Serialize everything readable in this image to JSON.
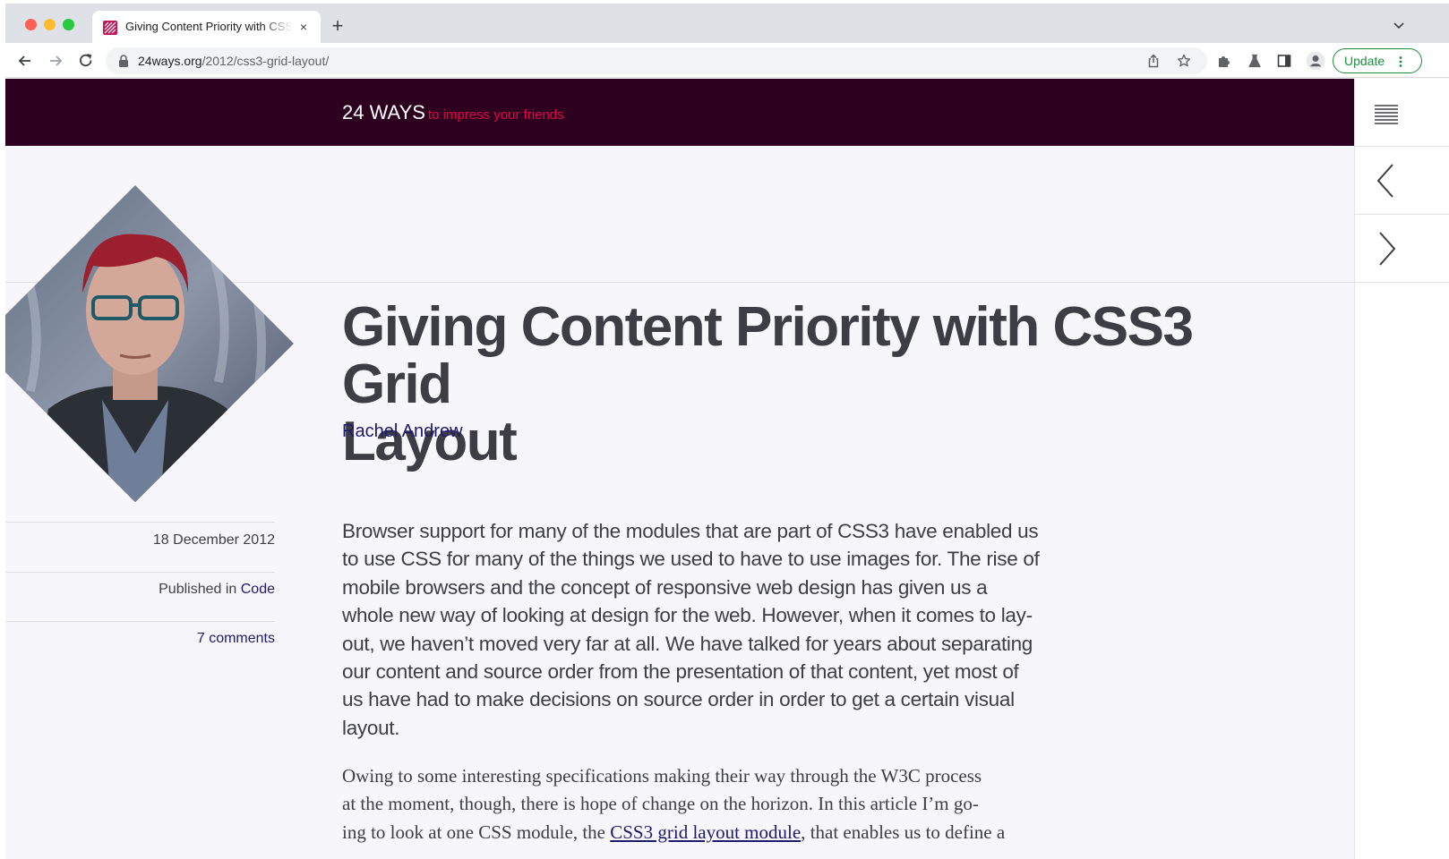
{
  "browser": {
    "tab_title": "Giving Content Priority with CSS3 Grid Layout",
    "tab_close": "×",
    "new_tab": "+",
    "url_host": "24ways.org",
    "url_path": "/2012/css3-grid-layout/",
    "update_label": "Update",
    "colors": {
      "update_green": "#1e8e3e",
      "tab_bar": "#dee1e6"
    }
  },
  "site": {
    "name": "24 WAYS",
    "tagline": "to impress your friends",
    "colors": {
      "masthead": "#2c001e",
      "tagline": "#e6004c",
      "link": "#1d1a6e"
    }
  },
  "article": {
    "title_line1": "Giving Content Priority with CSS3 Grid",
    "title_line2": "Layout",
    "author": "Rachel Andrew",
    "date": "18 December 2012",
    "published_prefix": "Published in",
    "category": "Code",
    "comments": "7 comments",
    "lead_lines": [
      "Browser support for many of the modules that are part of CSS3 have enabled us",
      "to use CSS for many of the things we used to have to use images for. The rise of",
      "mobile browsers and the concept of responsive web design has given us a",
      "whole new way of looking at design for the web. However, when it comes to lay-",
      "out, we haven’t moved very far at all. We have talked for years about separating",
      "our content and source order from the presentation of that content, yet most of",
      "us have had to make decisions on source order in order to get a certain visual",
      "layout."
    ],
    "body_line1": "Owing to some interesting specifications making their way through the W3C process",
    "body_line2": "at the moment, though, there is hope of change on the horizon. In this article I’m go-",
    "body_line3_pre": "ing to look at one CSS module, the ",
    "body_line3_link": "CSS3 grid layout module",
    "body_line3_post": ", that enables us to define a"
  },
  "icons": {
    "menu": "menu-lines-icon",
    "prev": "chevron-left-icon",
    "next": "chevron-right-icon"
  }
}
